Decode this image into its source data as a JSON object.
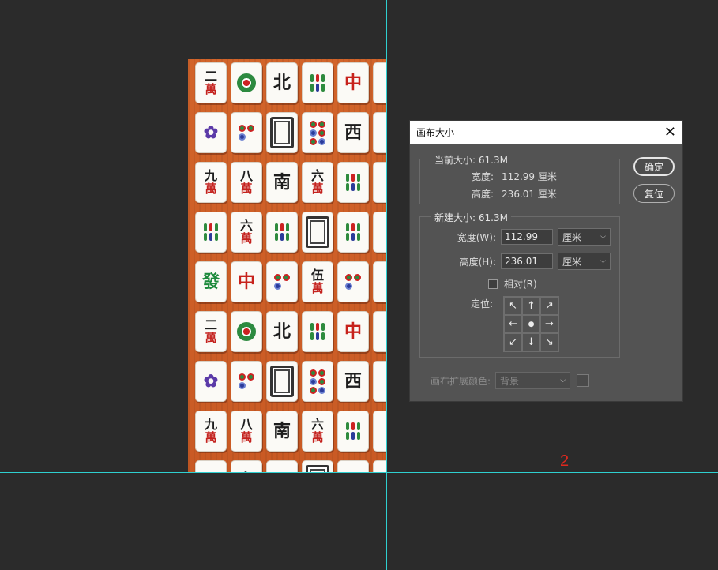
{
  "dialog": {
    "title": "画布大小",
    "close_icon": "close-icon",
    "current_size": {
      "title": "当前大小: 61.3M",
      "width_label": "宽度:",
      "width_value": "112.99 厘米",
      "height_label": "高度:",
      "height_value": "236.01 厘米"
    },
    "new_size": {
      "title": "新建大小: 61.3M",
      "width_label": "宽度(W):",
      "width_value": "112.99",
      "width_unit": "厘米",
      "height_label": "高度(H):",
      "height_value": "236.01",
      "height_unit": "厘米",
      "relative_label": "相对(R)",
      "anchor_label": "定位:",
      "anchor_cells": [
        "↖",
        "↑",
        "↗",
        "←",
        "●",
        "→",
        "↙",
        "↓",
        "↘"
      ]
    },
    "extension_color_label": "画布扩展颜色:",
    "extension_color_value": "背景",
    "ok_label": "确定",
    "reset_label": "复位"
  },
  "marker": "2",
  "guides": {
    "color": "#2fd0d0"
  },
  "tiles": [
    [
      "二萬",
      "circle",
      "北",
      "bars",
      "中",
      "edge"
    ],
    [
      "bird",
      "dots",
      "frame",
      "dots6",
      "西",
      "edge"
    ],
    [
      "九萬",
      "八萬",
      "南",
      "六萬",
      "bars",
      "edge"
    ],
    [
      "bars",
      "六萬",
      "bars",
      "frame",
      "bars",
      "edge"
    ],
    [
      "發",
      "中",
      "dots",
      "伍萬",
      "dots",
      "edge"
    ],
    [
      "二萬",
      "circle",
      "北",
      "bars",
      "中",
      "edge"
    ],
    [
      "bird",
      "dots",
      "frame",
      "dots6",
      "西",
      "edge"
    ],
    [
      "九萬",
      "八萬",
      "南",
      "六萬",
      "bars",
      "edge"
    ],
    [
      "bars",
      "六",
      "bars",
      "frame",
      "bars",
      "edge"
    ]
  ]
}
